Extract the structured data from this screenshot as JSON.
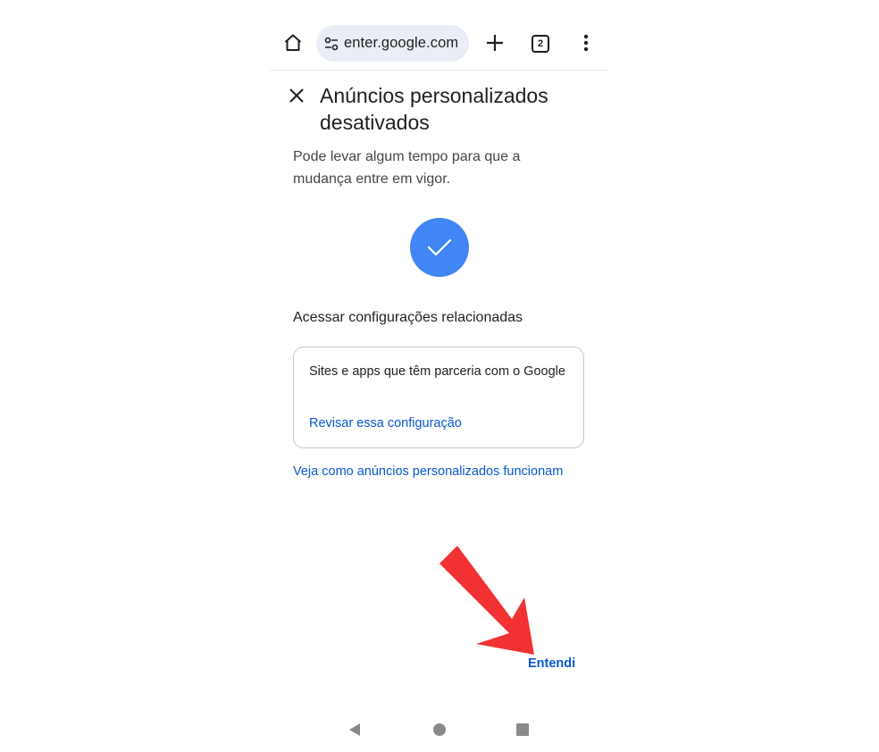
{
  "toolbar": {
    "home_icon": "home-icon",
    "url_text": "enter.google.com",
    "tune_icon": "tune-icon",
    "new_tab_icon": "plus-icon",
    "tab_count": "2",
    "menu_icon": "more-vert-icon"
  },
  "dialog": {
    "close_icon": "close-icon",
    "title": "Anúncios personalizados desativados",
    "subtitle": "Pode levar algum tempo para que a mudança entre em vigor.",
    "check_icon": "check-icon",
    "check_color": "#4285f4",
    "section_heading": "Acessar configurações relacionadas",
    "card": {
      "text": "Sites e apps que têm parceria com o Google",
      "link": "Revisar essa configuração"
    },
    "help_link": "Veja como anúncios personalizados funcionam",
    "confirm_button": "Entendi",
    "link_color": "#0b57d0"
  },
  "annotation": {
    "arrow_color": "#f23232",
    "arrow_icon": "red-arrow-icon"
  },
  "navbar": {
    "back_icon": "back-triangle-icon",
    "home_icon": "home-circle-icon",
    "recents_icon": "recents-square-icon"
  }
}
